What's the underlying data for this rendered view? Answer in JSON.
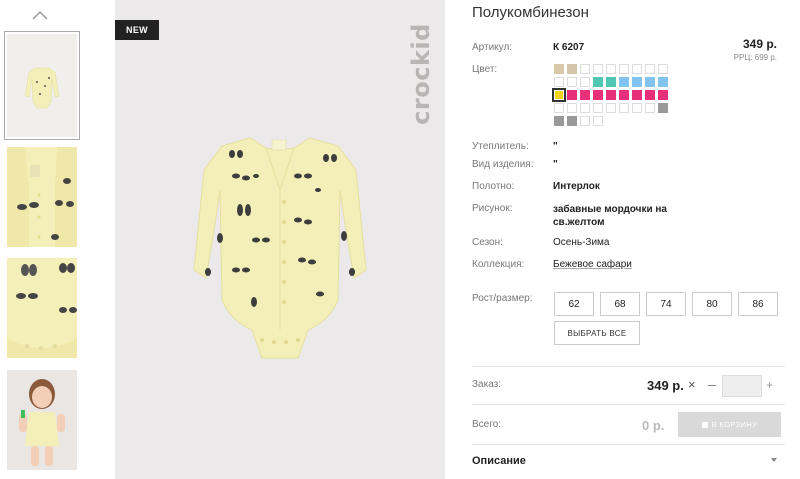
{
  "badge": "NEW",
  "brand": "crockid",
  "product": {
    "title": "Полукомбинезон",
    "price": "349 р.",
    "rrp": "РРЦ: 699 р."
  },
  "attributes": [
    {
      "label": "Артикул:",
      "value": "К 6207"
    },
    {
      "label": "Цвет:",
      "value": ""
    },
    {
      "label": "Утеплитель:",
      "value": "\""
    },
    {
      "label": "Вид изделия:",
      "value": "\""
    },
    {
      "label": "Полотно:",
      "value": "Интерлок"
    },
    {
      "label": "Рисунок:",
      "value": "забавные мордочки на св.желтом"
    },
    {
      "label": "Сезон:",
      "value": "Осень-Зима"
    },
    {
      "label": "Коллекция:",
      "value": "Бежевое сафари"
    },
    {
      "label": "Рост/размер:",
      "value": ""
    }
  ],
  "swatch_rows": [
    [
      "#d9c9a8",
      "#d4c6ab",
      "",
      "",
      "",
      "",
      "",
      "",
      ""
    ],
    [
      "",
      "",
      "",
      "#4fc7b2",
      "#4fc7b2",
      "#82c3ef",
      "#82c3ef",
      "#82c3ef",
      "#82c3ef"
    ],
    [
      "#f2d51a",
      "#e8307a",
      "#e8307a",
      "#e8307a",
      "#e8307a",
      "#e8307a",
      "#e8307a",
      "#e8307a",
      "#e8307a"
    ],
    [
      "",
      "",
      "",
      "",
      "",
      "",
      "",
      "",
      "#999999"
    ],
    [
      "#999999",
      "#999999",
      "",
      ""
    ]
  ],
  "sizes": [
    "62",
    "68",
    "74",
    "80",
    "86"
  ],
  "select_all": "ВЫБРАТЬ ВСЕ",
  "order": {
    "label": "Заказ:",
    "price": "349 р.",
    "remove": "×",
    "minus": "–",
    "plus": "+",
    "qty": ""
  },
  "total": {
    "label": "Всего:",
    "value": "0 р.",
    "cart_button": "В КОРЗИНУ"
  },
  "description_label": "Описание",
  "colors": {
    "bodysuit": "#f4efb8",
    "main_bg": "#ebe9e9",
    "cart_btn": "#d9d9d9"
  }
}
